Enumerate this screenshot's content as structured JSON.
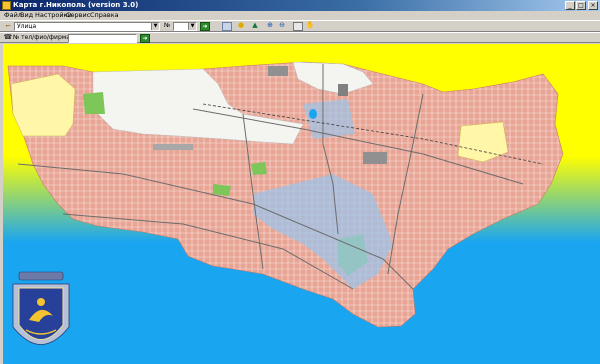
{
  "window": {
    "title": "Карта г.Никополь (version 3.0)",
    "controls": {
      "minimize": "_",
      "maximize": "□",
      "close": "×"
    }
  },
  "menu": [
    "Файл",
    "Вид",
    "Настройки",
    "Сервис",
    "Справка"
  ],
  "toolbar": {
    "street_combo": {
      "value": "Улица"
    },
    "number_label": "№",
    "number_value": ""
  },
  "search": {
    "label": "№ тел/фио/фирма:",
    "value": ""
  },
  "colors": {
    "sea": "#1aa5f0",
    "land_top": "#ffff00",
    "land_bottom": "#22b8e8",
    "urban": "#e8a494",
    "urban_dark": "#d28a78",
    "industrial": "#f4f4f0",
    "park": "#7cc65a",
    "pale_yellow": "#fff6a8"
  },
  "icons": [
    "app-icon",
    "street-icon",
    "go-arrow-icon",
    "layers-icon",
    "bulb-icon",
    "bus-icon",
    "zoom-in-icon",
    "zoom-out-icon",
    "print-icon",
    "hand-icon",
    "phone-icon",
    "coat-of-arms-icon"
  ]
}
